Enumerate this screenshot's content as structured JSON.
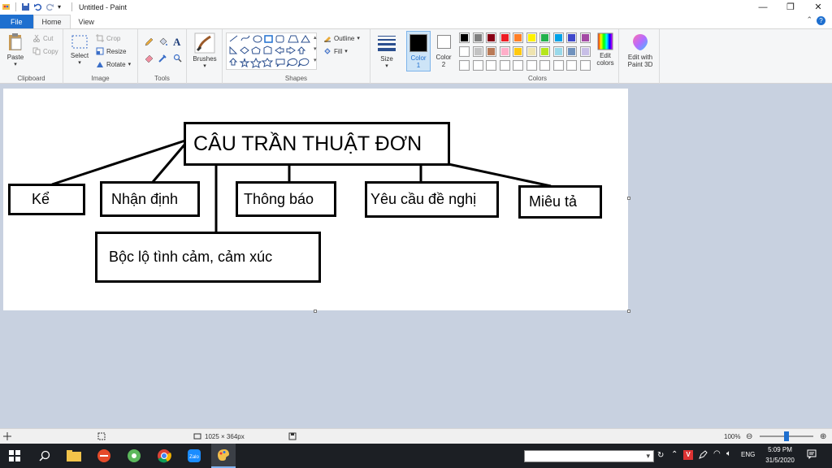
{
  "window": {
    "title": "Untitled - Paint",
    "controls": {
      "minimize": "—",
      "maximize": "❐",
      "close": "✕"
    }
  },
  "tabs": [
    {
      "label": "File"
    },
    {
      "label": "Home"
    },
    {
      "label": "View"
    }
  ],
  "ribbon": {
    "clipboard": {
      "label": "Clipboard",
      "paste": "Paste",
      "cut": "Cut",
      "copy": "Copy"
    },
    "image": {
      "label": "Image",
      "select": "Select",
      "crop": "Crop",
      "resize": "Resize",
      "rotate": "Rotate"
    },
    "tools": {
      "label": "Tools"
    },
    "brushes": {
      "label": "Brushes"
    },
    "shapes": {
      "label": "Shapes",
      "outline": "Outline",
      "fill": "Fill"
    },
    "size": {
      "label": "Size"
    },
    "color1": {
      "label": "Color",
      "num": "1",
      "color": "#000000"
    },
    "color2": {
      "label": "Color",
      "num": "2",
      "color": "#ffffff"
    },
    "colors": {
      "label": "Colors",
      "row1": [
        "#000000",
        "#7f7f7f",
        "#880015",
        "#ed1c24",
        "#ff7f27",
        "#fff200",
        "#22b14c",
        "#00a2e8",
        "#3f48cc",
        "#a349a4"
      ],
      "row2": [
        "#ffffff",
        "#c3c3c3",
        "#b97a57",
        "#ffaec9",
        "#ffc90e",
        "#efe4b0",
        "#b5e61d",
        "#99d9ea",
        "#7092be",
        "#c8bfe7"
      ],
      "row3": [
        "#ffffff",
        "#ffffff",
        "#ffffff",
        "#ffffff",
        "#ffffff",
        "#ffffff",
        "#ffffff",
        "#ffffff",
        "#ffffff",
        "#ffffff"
      ]
    },
    "edit_colors": {
      "line1": "Edit",
      "line2": "colors"
    },
    "paint3d": {
      "line1": "Edit with",
      "line2": "Paint 3D"
    }
  },
  "diagram": {
    "root": "CÂU TRẦN THUẬT ĐƠN",
    "children": [
      {
        "label": "Kể"
      },
      {
        "label": "Nhận định"
      },
      {
        "label": "Thông báo"
      },
      {
        "label": "Yêu cầu đề nghị"
      },
      {
        "label": "Miêu tả"
      },
      {
        "label": "Bộc lộ tình cảm, cảm xúc"
      }
    ]
  },
  "statusbar": {
    "size": "1025 × 364px",
    "zoom": "100%",
    "zoom_level": 1.0
  },
  "taskbar": {
    "tray_lang": "ENG",
    "time": "5:09 PM",
    "date": "31/5/2020"
  }
}
